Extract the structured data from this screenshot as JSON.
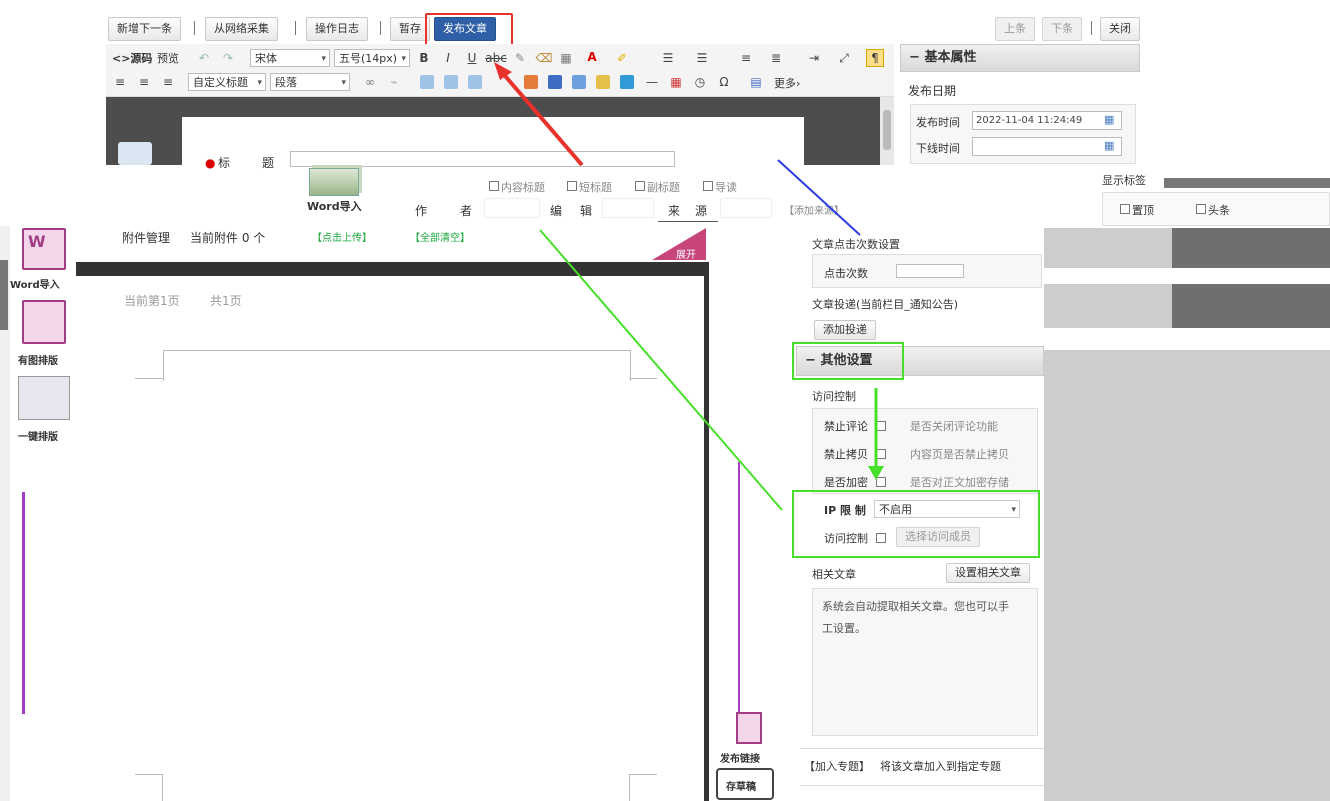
{
  "toolbar": {
    "new_next": "新增下一条",
    "collect": "从网络采集",
    "log": "操作日志",
    "draft": "暂存",
    "publish": "发布文章",
    "prev": "上条",
    "next": "下条",
    "close": "关闭"
  },
  "editor": {
    "source": "<>源码",
    "preview": "预览",
    "font_family": "宋体",
    "font_size": "五号(14px)",
    "custom_heading": "自定义标题",
    "paragraph": "段落",
    "more": "更多›"
  },
  "form": {
    "title_label": "标",
    "title_label2": "题",
    "word_import": "Word导入",
    "flag_inner": "内容标题",
    "flag_sub": "短标题",
    "flag_dup": "副标题",
    "flag_tag": "导读",
    "author_label": "作",
    "author_label2": "者",
    "editor_label": "编",
    "editor_label2": "辑",
    "source_label": "来",
    "source_label2": "源",
    "add_source": "【添加来源】",
    "attach_label": "附件管理",
    "attach_count": "当前附件 0 个",
    "attach_upload": "【点击上传】",
    "attach_clear": "【全部清空】",
    "expand": "展开",
    "page_info": "当前第1页",
    "page_total": "共1页"
  },
  "left_tools": {
    "word": "Word导入",
    "layout": "有图排版",
    "one_click": "一键排版"
  },
  "bottom_tools": {
    "publish_article": "发布链接",
    "save_draft": "存草稿"
  },
  "sidebar": {
    "basic_head": "基本属性",
    "publish_date": "发布日期",
    "publish_time_label": "发布时间",
    "publish_time_value": "2022-11-04 11:24:49",
    "offline_time_label": "下线时间",
    "show_flag_label": "显示标签",
    "flag_top": "置顶",
    "flag_headline": "头条",
    "click_setting": "文章点击次数设置",
    "click_count_label": "点击次数",
    "push_label": "文章投递(当前栏目_通知公告)",
    "add_push": "添加投递",
    "other_head": "其他设置",
    "access_control": "访问控制",
    "no_comment_label": "禁止评论",
    "no_comment_desc": "是否关闭评论功能",
    "no_copy_label": "禁止拷贝",
    "no_copy_desc": "内容页是否禁止拷贝",
    "encrypt_label": "是否加密",
    "encrypt_desc": "是否对正文加密存储",
    "ip_label": "IP 限 制",
    "ip_value": "不启用",
    "visit_label": "访问控制",
    "visit_button": "选择访问成员",
    "related_label": "相关文章",
    "related_button": "设置相关文章",
    "related_desc_1": "系统会自动提取相关文章。您也可以手",
    "related_desc_2": "工设置。",
    "topic_label": "【加入专题】",
    "topic_desc": "将该文章加入到指定专题"
  }
}
